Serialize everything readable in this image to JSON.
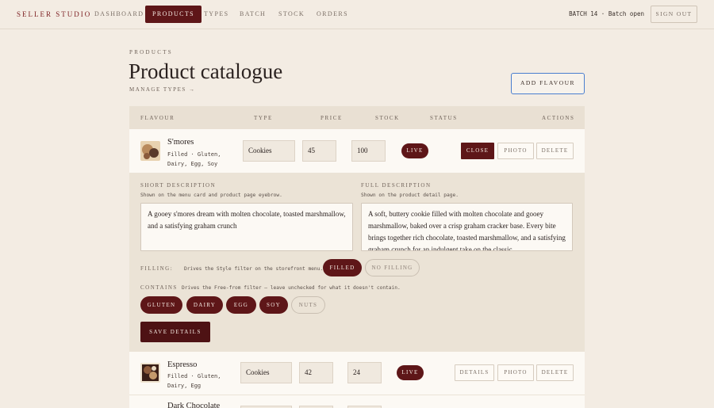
{
  "nav": {
    "brand": "SELLER STUDIO",
    "links": [
      "DASHBOARD",
      "PRODUCTS",
      "TYPES",
      "BATCH",
      "STOCK",
      "ORDERS"
    ],
    "active": "PRODUCTS",
    "batch_status": "BATCH 14 · Batch open",
    "sign_out": "SIGN OUT"
  },
  "header": {
    "eyebrow": "PRODUCTS",
    "title": "Product catalogue",
    "manage_link": "MANAGE TYPES →",
    "add_button": "ADD FLAVOUR"
  },
  "table": {
    "columns": [
      "FLAVOUR",
      "TYPE",
      "PRICE",
      "STOCK",
      "STATUS",
      "ACTIONS"
    ],
    "rows": [
      {
        "name": "S'mores",
        "meta": "Filled · Gluten, Dairy, Egg, Soy",
        "type": "Cookies",
        "price": "45",
        "stock": "100",
        "status": "LIVE",
        "actions": [
          "CLOSE",
          "PHOTO",
          "DELETE"
        ],
        "thumb_colors": [
          "#5a3a2a",
          "#b98a5c",
          "#e8d2b0"
        ]
      },
      {
        "name": "Espresso",
        "meta": "Filled · Gluten, Dairy, Egg",
        "type": "Cookies",
        "price": "42",
        "stock": "24",
        "status": "LIVE",
        "actions": [
          "DETAILS",
          "PHOTO",
          "DELETE"
        ],
        "thumb_colors": [
          "#3a1f17",
          "#8c5a3a",
          "#f0e4d0"
        ]
      },
      {
        "name": "Dark Chocolate"
      }
    ]
  },
  "editor": {
    "short_label": "SHORT DESCRIPTION",
    "short_hint": "Shown on the menu card and product page eyebrow.",
    "short_value": "A gooey s'mores dream with molten chocolate, toasted marshmallow, and a satisfying graham crunch",
    "full_label": "FULL DESCRIPTION",
    "full_hint": "Shown on the product detail page.",
    "full_value": "A soft, buttery cookie filled with molten chocolate and gooey marshmallow, baked over a crisp graham cracker base. Every bite brings together rich chocolate, toasted marshmallow, and a satisfying graham crunch for an indulgent take on the classic",
    "filling_label": "FILLING",
    "filling_hint": "Drives the Style filter on the storefront menu.",
    "filling_options": [
      "FILLED",
      "NO FILLING"
    ],
    "contains_label": "CONTAINS",
    "contains_hint": "Drives the Free-from filter — leave unchecked for what it doesn't contain.",
    "allergens": [
      {
        "label": "GLUTEN",
        "on": true
      },
      {
        "label": "DAIRY",
        "on": true
      },
      {
        "label": "EGG",
        "on": true
      },
      {
        "label": "SOY",
        "on": true
      },
      {
        "label": "NUTS",
        "on": false
      }
    ],
    "save_button": "SAVE DETAILS"
  }
}
